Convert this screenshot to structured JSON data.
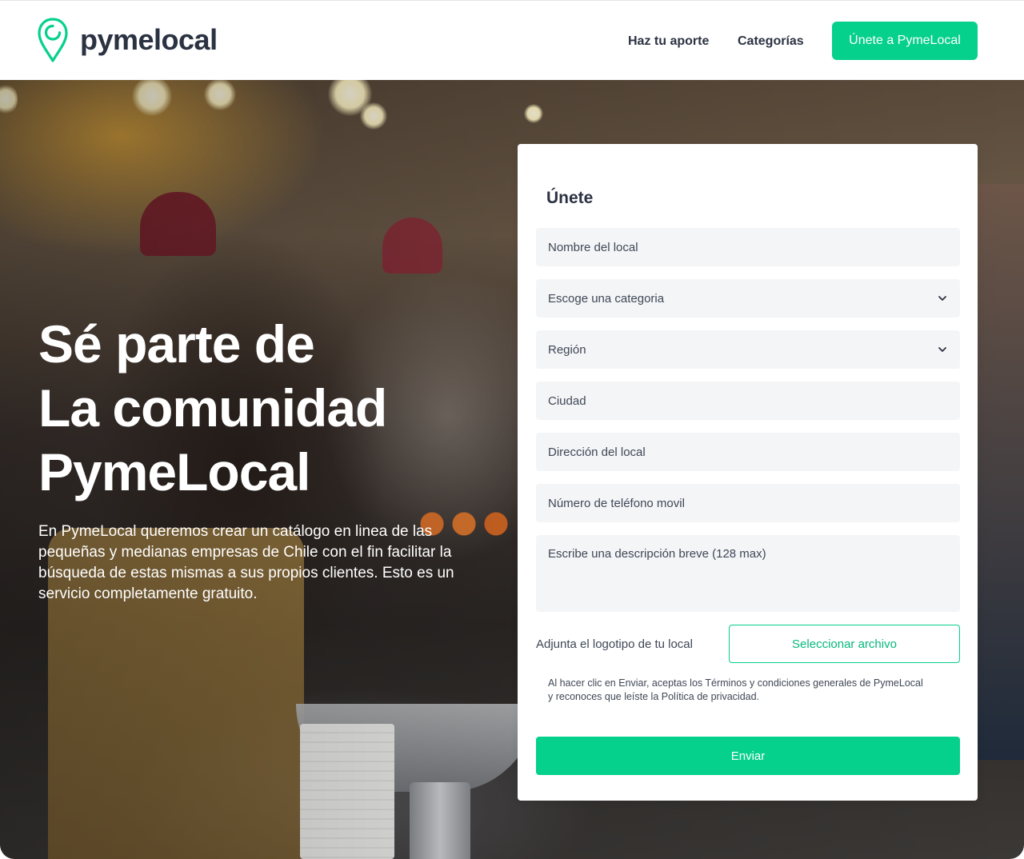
{
  "brand": {
    "name": "pymelocal",
    "accent_color": "#05d08c",
    "text_color": "#2b3242"
  },
  "header": {
    "nav": [
      {
        "label": "Haz tu aporte"
      },
      {
        "label": "Categorías"
      }
    ],
    "cta_label": "Únete a PymeLocal"
  },
  "hero": {
    "title_lines": [
      "Sé parte de",
      "La comunidad",
      "PymeLocal"
    ],
    "description": "En PymeLocal queremos crear un catálogo en linea de las pequeñas y medianas empresas de Chile con el fin facilitar la búsqueda de estas mismas a sus propios clientes. Esto es un servicio completamente gratuito."
  },
  "form": {
    "title": "Únete",
    "fields": {
      "nombre_placeholder": "Nombre del local",
      "categoria_placeholder": "Escoge una categoria",
      "region_placeholder": "Región",
      "ciudad_placeholder": "Ciudad",
      "direccion_placeholder": "Dirección del local",
      "telefono_placeholder": "Número de teléfono movil",
      "descripcion_placeholder": "Escribe una descripción breve (128 max)"
    },
    "logo_label": "Adjunta el logotipo de tu local",
    "file_button_label": "Seleccionar archivo",
    "terms_line1": "Al hacer clic en Enviar, aceptas los Términos y condiciones generales de PymeLocal",
    "terms_line2": "y reconoces que leíste la Política de privacidad.",
    "submit_label": "Enviar"
  },
  "icons": [
    "location-pin-logo-icon",
    "chevron-down-icon"
  ]
}
